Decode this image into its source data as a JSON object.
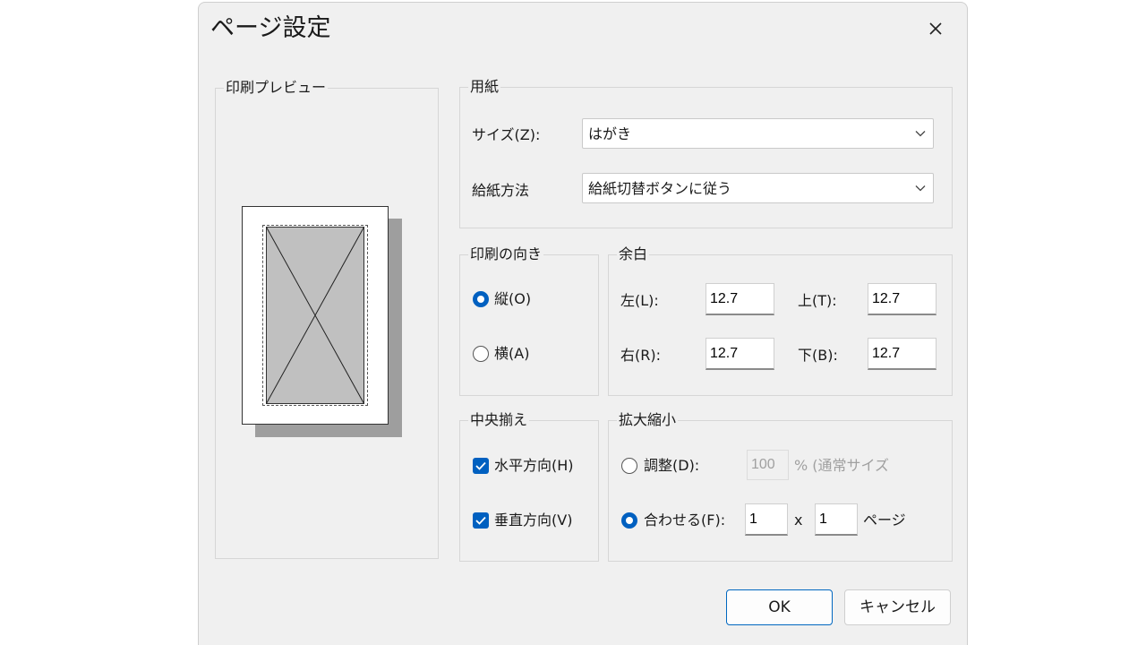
{
  "dialog": {
    "title": "ページ設定"
  },
  "preview": {
    "legend": "印刷プレビュー"
  },
  "paper": {
    "legend": "用紙",
    "size_label": "サイズ(Z):",
    "size_value": "はがき",
    "source_label": "給紙方法",
    "source_value": "給紙切替ボタンに従う"
  },
  "orientation": {
    "legend": "印刷の向き",
    "portrait_label": "縦(O)",
    "landscape_label": "横(A)",
    "selected": "portrait"
  },
  "margins": {
    "legend": "余白",
    "left_label": "左(L):",
    "left_value": "12.7",
    "top_label": "上(T):",
    "top_value": "12.7",
    "right_label": "右(R):",
    "right_value": "12.7",
    "bottom_label": "下(B):",
    "bottom_value": "12.7"
  },
  "centering": {
    "legend": "中央揃え",
    "horizontal_label": "水平方向(H)",
    "horizontal_checked": true,
    "vertical_label": "垂直方向(V)",
    "vertical_checked": true
  },
  "scaling": {
    "legend": "拡大縮小",
    "adjust_label": "調整(D):",
    "adjust_value": "100",
    "adjust_suffix": "% (通常サイズ",
    "fit_label": "合わせる(F):",
    "fit_wide": "1",
    "times": "x",
    "fit_tall": "1",
    "pages_label": "ページ",
    "selected": "fit"
  },
  "buttons": {
    "ok": "OK",
    "cancel": "キャンセル"
  },
  "colors": {
    "accent": "#0060c0",
    "dialog_bg": "#f0f0f0",
    "preview_fill": "#c0c0c0",
    "shadow": "#9e9e9e"
  },
  "icons": {
    "close": "close-icon",
    "dropdown": "chevron-down-icon",
    "check": "checkmark-icon"
  }
}
